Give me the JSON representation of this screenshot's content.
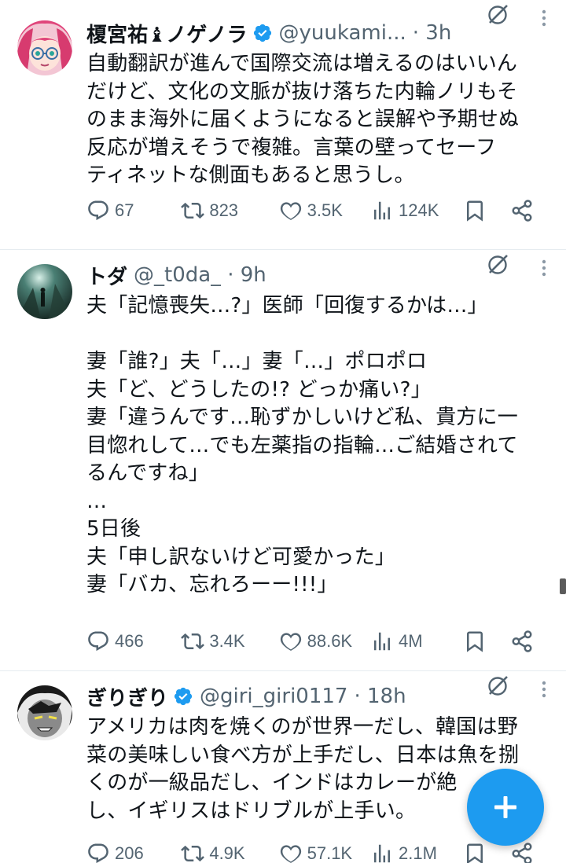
{
  "tweets": [
    {
      "author_name": "榎宮祐♝ノゲノラ",
      "verified": true,
      "handle": "@yuukami...",
      "time": "· 3h",
      "text": "自動翻訳が進んで国際交流は増えるのはいいん\nだけど、文化の文脈が抜け落ちた内輪ノリもそ\nのまま海外に届くようになると誤解や予期せぬ\n反応が増えそうで複雑。言葉の壁ってセーフ\nティネットな側面もあると思うし。",
      "replies": "67",
      "retweets": "823",
      "likes": "3.5K",
      "views": "124K"
    },
    {
      "author_name": "トダ",
      "verified": false,
      "handle": "@_t0da_",
      "time": "· 9h",
      "text": "夫「記憶喪失…?」医師「回復するかは…」\n\n妻「誰?」夫「…」妻「…」ポロポロ\n夫「ど、どうしたの!? どっか痛い?」\n妻「違うんです…恥ずかしいけど私、貴方に一\n目惚れして…でも左薬指の指輪…ご結婚されて\nるんですね」\n…\n5日後\n夫「申し訳ないけど可愛かった」\n妻「バカ、忘れろーー!!!」",
      "replies": "466",
      "retweets": "3.4K",
      "likes": "88.6K",
      "views": "4M"
    },
    {
      "author_name": "ぎりぎり",
      "verified": true,
      "handle": "@giri_giri0117",
      "time": "· 18h",
      "text": "アメリカは肉を焼くのが世界一だし、韓国は野\n菜の美味しい食べ方が上手だし、日本は魚を捌\nくのが一級品だし、インドはカレーが絶\nし、イギリスはドリブルが上手い。",
      "replies": "206",
      "retweets": "4.9K",
      "likes": "57.1K",
      "views": "2.1M"
    }
  ],
  "icons": {
    "reply": "reply-icon",
    "retweet": "retweet-icon",
    "like": "heart-icon",
    "views": "views-icon",
    "bookmark": "bookmark-icon",
    "share": "share-icon",
    "grok": "grok-icon",
    "more": "more-icon",
    "compose": "plus-icon"
  },
  "colors": {
    "accent": "#1d9bf0",
    "text": "#0f1419",
    "secondary": "#536471",
    "divider": "#e6ecf0"
  }
}
